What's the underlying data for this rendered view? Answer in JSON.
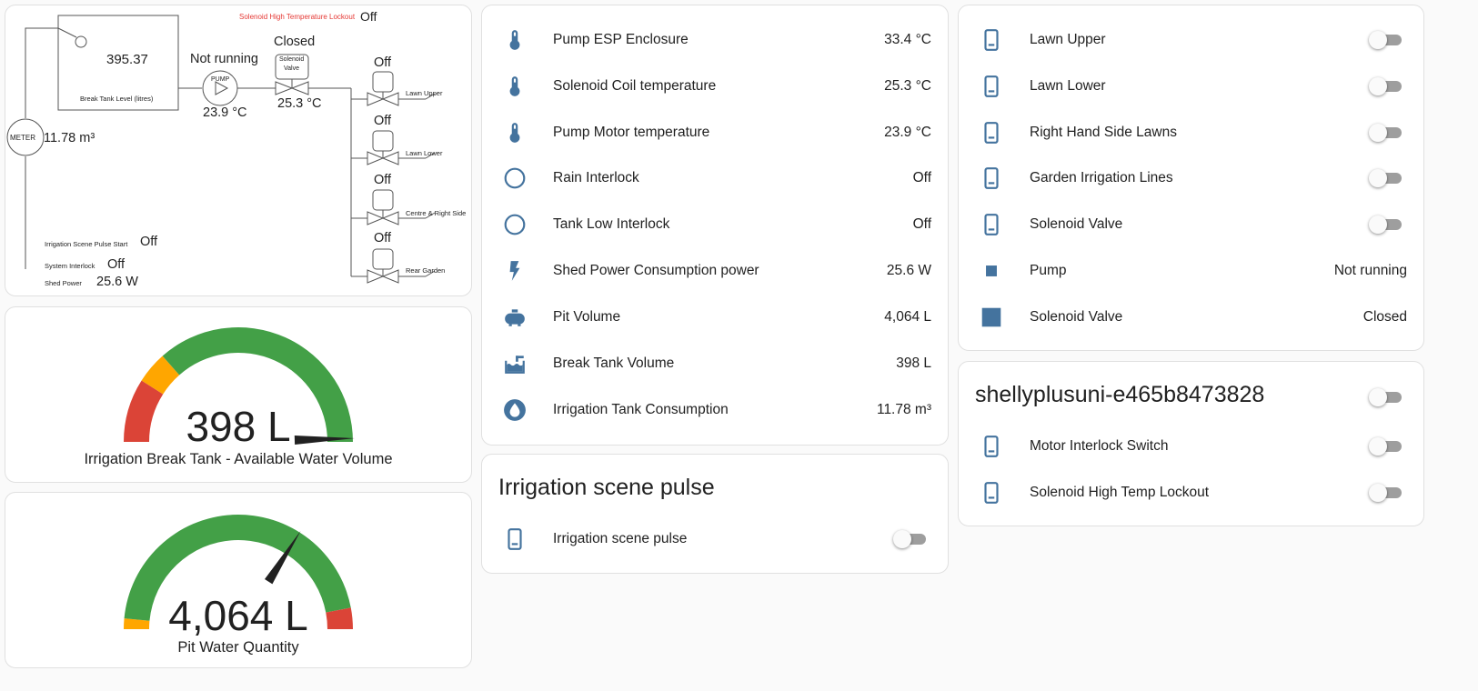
{
  "colors": {
    "icon": "#44739e",
    "gauge_green": "#43a047",
    "gauge_yellow": "#ffa600",
    "gauge_red": "#db4437",
    "lockout_red": "#e53935"
  },
  "diagram": {
    "lockout_label": "Solenoid High Temperature Lockout",
    "lockout_value": "Off",
    "tank_level": "395.37",
    "tank_label": "Break Tank Level (litres)",
    "pump_status": "Not running",
    "pump_label": "PUMP",
    "pump_temp": "23.9 °C",
    "valve_status": "Closed",
    "valve_label_1": "Solenoid",
    "valve_label_2": "Valve",
    "valve_temp": "25.3 °C",
    "meter_label": "METER",
    "meter_value": "11.78 m³",
    "zones": [
      {
        "status": "Off",
        "name": "Lawn Upper"
      },
      {
        "status": "Off",
        "name": "Lawn Lower"
      },
      {
        "status": "Off",
        "name": "Centre & Right Side"
      },
      {
        "status": "Off",
        "name": "Rear Garden"
      }
    ],
    "pulse_label": "Irrigation Scene Pulse Start",
    "pulse_value": "Off",
    "interlock_label": "System Interlock",
    "interlock_value": "Off",
    "power_label": "Shed Power",
    "power_value": "25.6 W"
  },
  "gauge_tank": {
    "value_text": "398 L",
    "name": "Irrigation Break Tank - Available Water Volume",
    "level": 0.99,
    "segments": [
      {
        "color": "red",
        "from": 0,
        "to": 0.18
      },
      {
        "color": "yellow",
        "from": 0.18,
        "to": 0.27
      },
      {
        "color": "green",
        "from": 0.27,
        "to": 1
      }
    ]
  },
  "gauge_pit": {
    "value_text": "4,064 L",
    "name": "Pit Water Quantity",
    "level": 0.68,
    "segments": [
      {
        "color": "yellow",
        "from": 0,
        "to": 0.03
      },
      {
        "color": "green",
        "from": 0.03,
        "to": 0.94
      },
      {
        "color": "red",
        "from": 0.94,
        "to": 1
      }
    ]
  },
  "sensors": [
    {
      "icon": "thermometer-icon",
      "label": "Pump ESP Enclosure",
      "value": "33.4 °C"
    },
    {
      "icon": "thermometer-icon",
      "label": "Solenoid Coil temperature",
      "value": "25.3 °C"
    },
    {
      "icon": "thermometer-icon",
      "label": "Pump Motor temperature",
      "value": "23.9 °C"
    },
    {
      "icon": "circle-outline-icon",
      "label": "Rain Interlock",
      "value": "Off"
    },
    {
      "icon": "circle-outline-icon",
      "label": "Tank Low Interlock",
      "value": "Off"
    },
    {
      "icon": "flash-icon",
      "label": "Shed Power Consumption power",
      "value": "25.6 W"
    },
    {
      "icon": "propane-tank-icon",
      "label": "Pit Volume",
      "value": "4,064 L"
    },
    {
      "icon": "water-tank-icon",
      "label": "Break Tank Volume",
      "value": "398 L"
    },
    {
      "icon": "water-drop-icon",
      "label": "Irrigation Tank Consumption",
      "value": "11.78 m³"
    }
  ],
  "pulse_card": {
    "title": "Irrigation scene pulse",
    "row_label": "Irrigation scene pulse",
    "icon": "cellphone-icon"
  },
  "switches": [
    {
      "icon": "cellphone-icon",
      "label": "Lawn Upper",
      "type": "toggle"
    },
    {
      "icon": "cellphone-icon",
      "label": "Lawn Lower",
      "type": "toggle"
    },
    {
      "icon": "cellphone-icon",
      "label": "Right Hand Side Lawns",
      "type": "toggle"
    },
    {
      "icon": "cellphone-icon",
      "label": "Garden Irrigation Lines",
      "type": "toggle"
    },
    {
      "icon": "cellphone-icon",
      "label": "Solenoid Valve",
      "type": "toggle"
    },
    {
      "icon": "stop-small-icon",
      "label": "Pump",
      "type": "text",
      "value": "Not running"
    },
    {
      "icon": "stop-large-icon",
      "label": "Solenoid Valve",
      "type": "text",
      "value": "Closed"
    }
  ],
  "shelly": {
    "title": "shellyplusuni-e465b8473828",
    "rows": [
      {
        "icon": "cellphone-icon",
        "label": "Motor Interlock Switch"
      },
      {
        "icon": "cellphone-icon",
        "label": "Solenoid High Temp Lockout"
      }
    ]
  }
}
